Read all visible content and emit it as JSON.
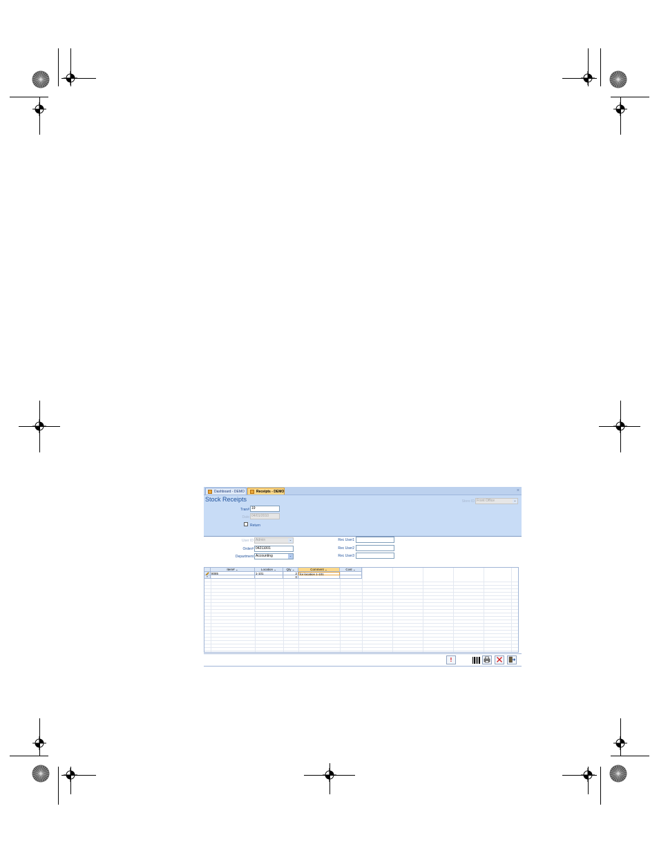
{
  "tabs": [
    {
      "label": "Dashboard - DEMO",
      "active": false
    },
    {
      "label": "Receipts - DEMO",
      "active": true
    }
  ],
  "form": {
    "title": "Stock Receipts",
    "trans_label": "Tran#",
    "trans_value": "19",
    "date_label": "Date",
    "date_value": "04/01/2010",
    "return_label": "Return",
    "store_label": "Store ID",
    "store_value": "Front Office",
    "user_label": "User ID",
    "user_value": "Admin",
    "order_label": "Order#",
    "order_value": "04211001",
    "dept_label": "Department",
    "dept_value": "Accounting",
    "rec_user1_label": "Rec User1",
    "rec_user2_label": "Rec User2",
    "rec_user3_label": "Rec User3",
    "rec_user1_value": "",
    "rec_user2_value": "",
    "rec_user3_value": ""
  },
  "grid": {
    "columns": [
      "Item#",
      "Location",
      "Qty",
      "Comment",
      "Cost"
    ],
    "rows": [
      {
        "item": "8085",
        "location": "1-101",
        "qty": "2",
        "comment": "for location 1-101",
        "cost": ""
      },
      {
        "item": "",
        "location": "",
        "qty": "0",
        "comment": "",
        "cost": ""
      }
    ]
  },
  "icons": {
    "tab_icon": "form-icon",
    "alert": "exclamation-icon",
    "barcode": "barcode-icon",
    "print": "printer-icon",
    "delete": "x-delete-icon",
    "exit": "exit-door-icon"
  },
  "colors": {
    "header_bg": "#c8dcf6",
    "active_tab": "#fbd88a",
    "label_blue": "#1d4f9a",
    "delete_red": "#d62020",
    "alert_red": "#cc0000"
  },
  "labels": {
    "alert_glyph": "!",
    "close_glyph": "×",
    "new_row_glyph": "*",
    "sort_glyph": "⌄"
  }
}
